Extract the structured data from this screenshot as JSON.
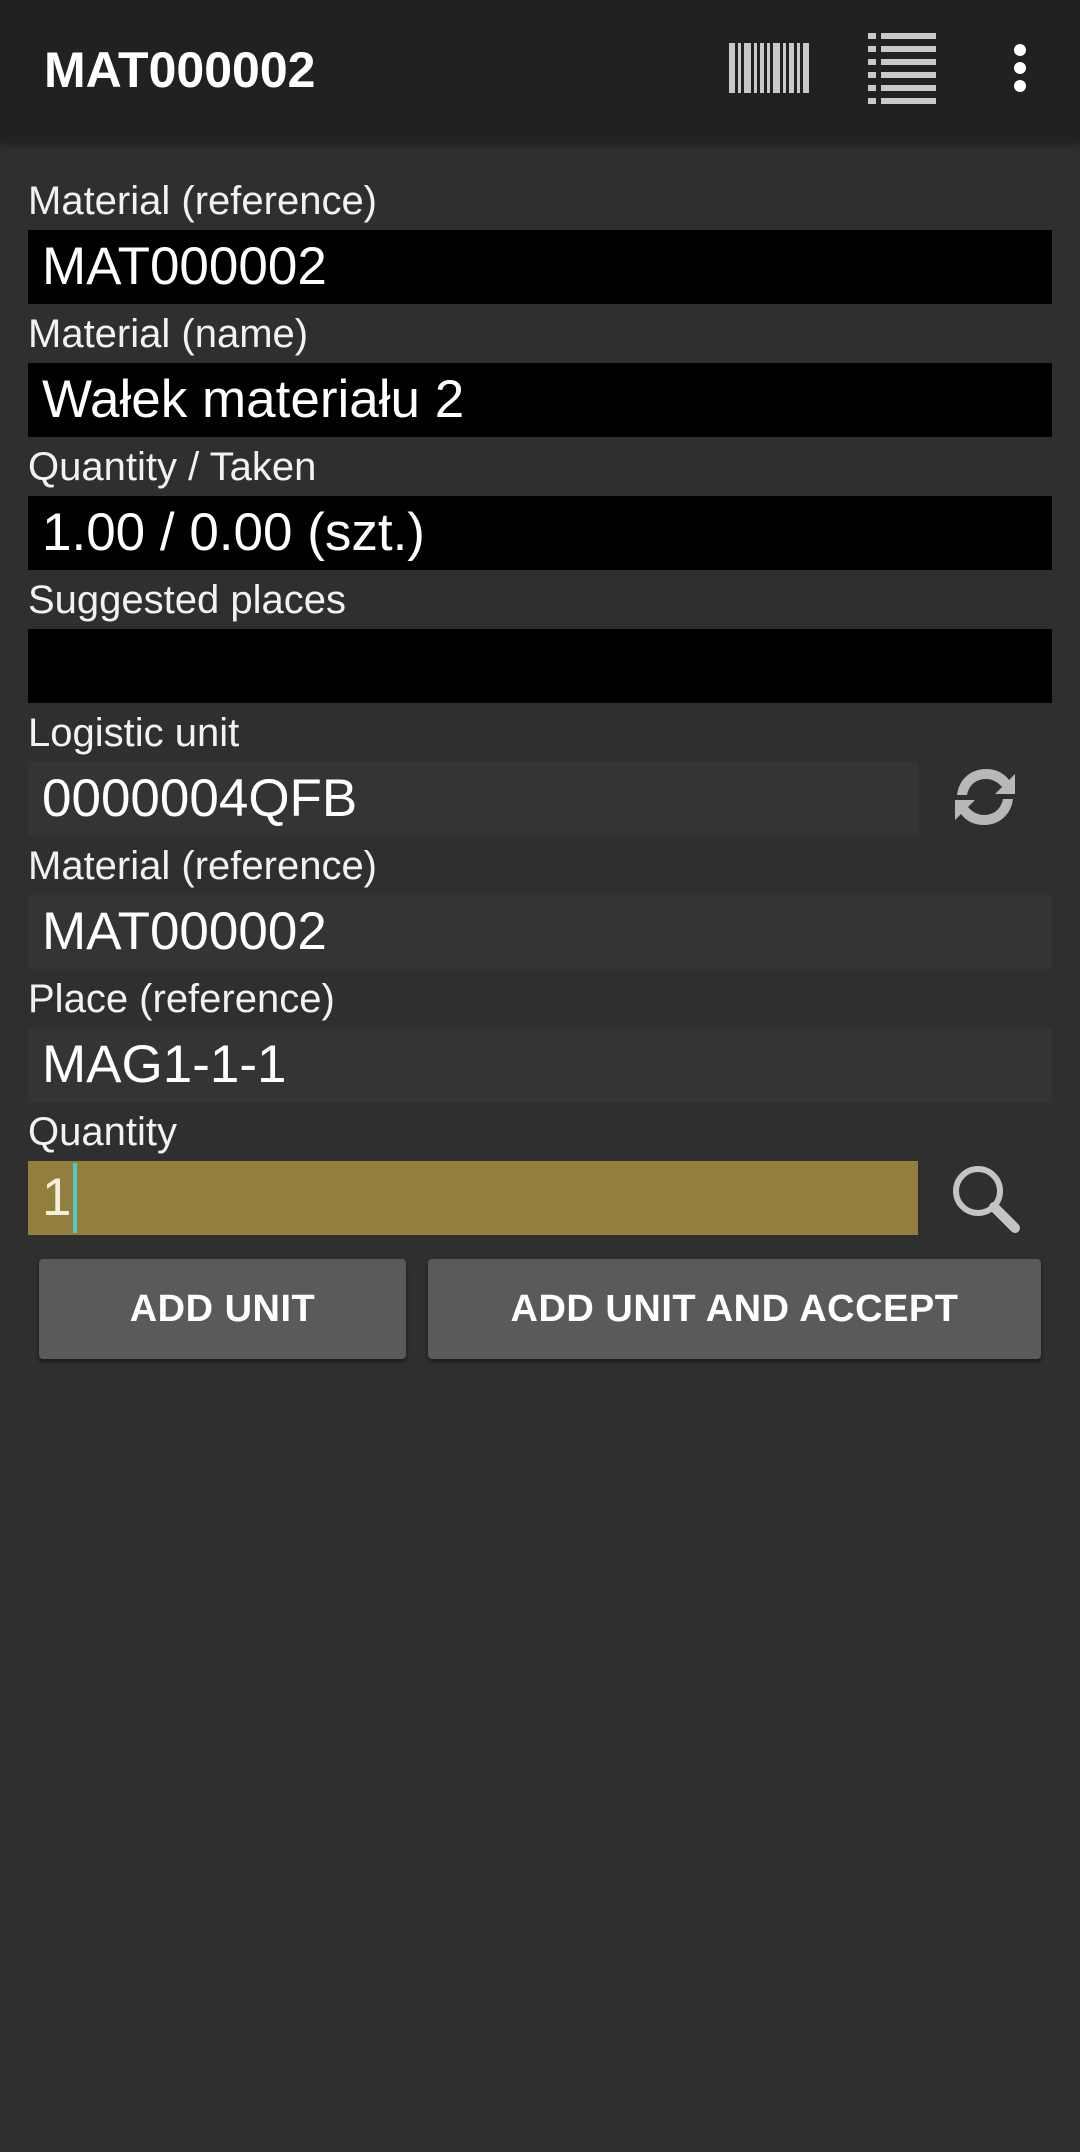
{
  "appbar": {
    "title": "MAT000002",
    "icons": [
      "barcode-icon",
      "list-icon",
      "more-vert-icon"
    ]
  },
  "form": {
    "readonly": [
      {
        "label": "Material (reference)",
        "value": "MAT000002"
      },
      {
        "label": "Material (name)",
        "value": "Wałek materiału 2"
      },
      {
        "label": "Quantity / Taken",
        "value": "1.00 / 0.00 (szt.)"
      },
      {
        "label": "Suggested places",
        "value": ""
      }
    ],
    "logistic_unit": {
      "label": "Logistic unit",
      "value": "0000004QFB"
    },
    "material_reference": {
      "label": "Material (reference)",
      "value": "MAT000002"
    },
    "place_reference": {
      "label": "Place (reference)",
      "value": "MAG1-1-1"
    },
    "quantity": {
      "label": "Quantity",
      "value": "1"
    }
  },
  "buttons": {
    "add_unit": "ADD UNIT",
    "add_unit_and_accept": "ADD UNIT AND ACCEPT"
  },
  "colors": {
    "background": "#2f2f2f",
    "appbar": "#212121",
    "readonly_field": "#000000",
    "editable_field": "#343434",
    "active_field": "#927f3e",
    "cursor": "#56c7c4",
    "button": "#5a5a5a"
  }
}
